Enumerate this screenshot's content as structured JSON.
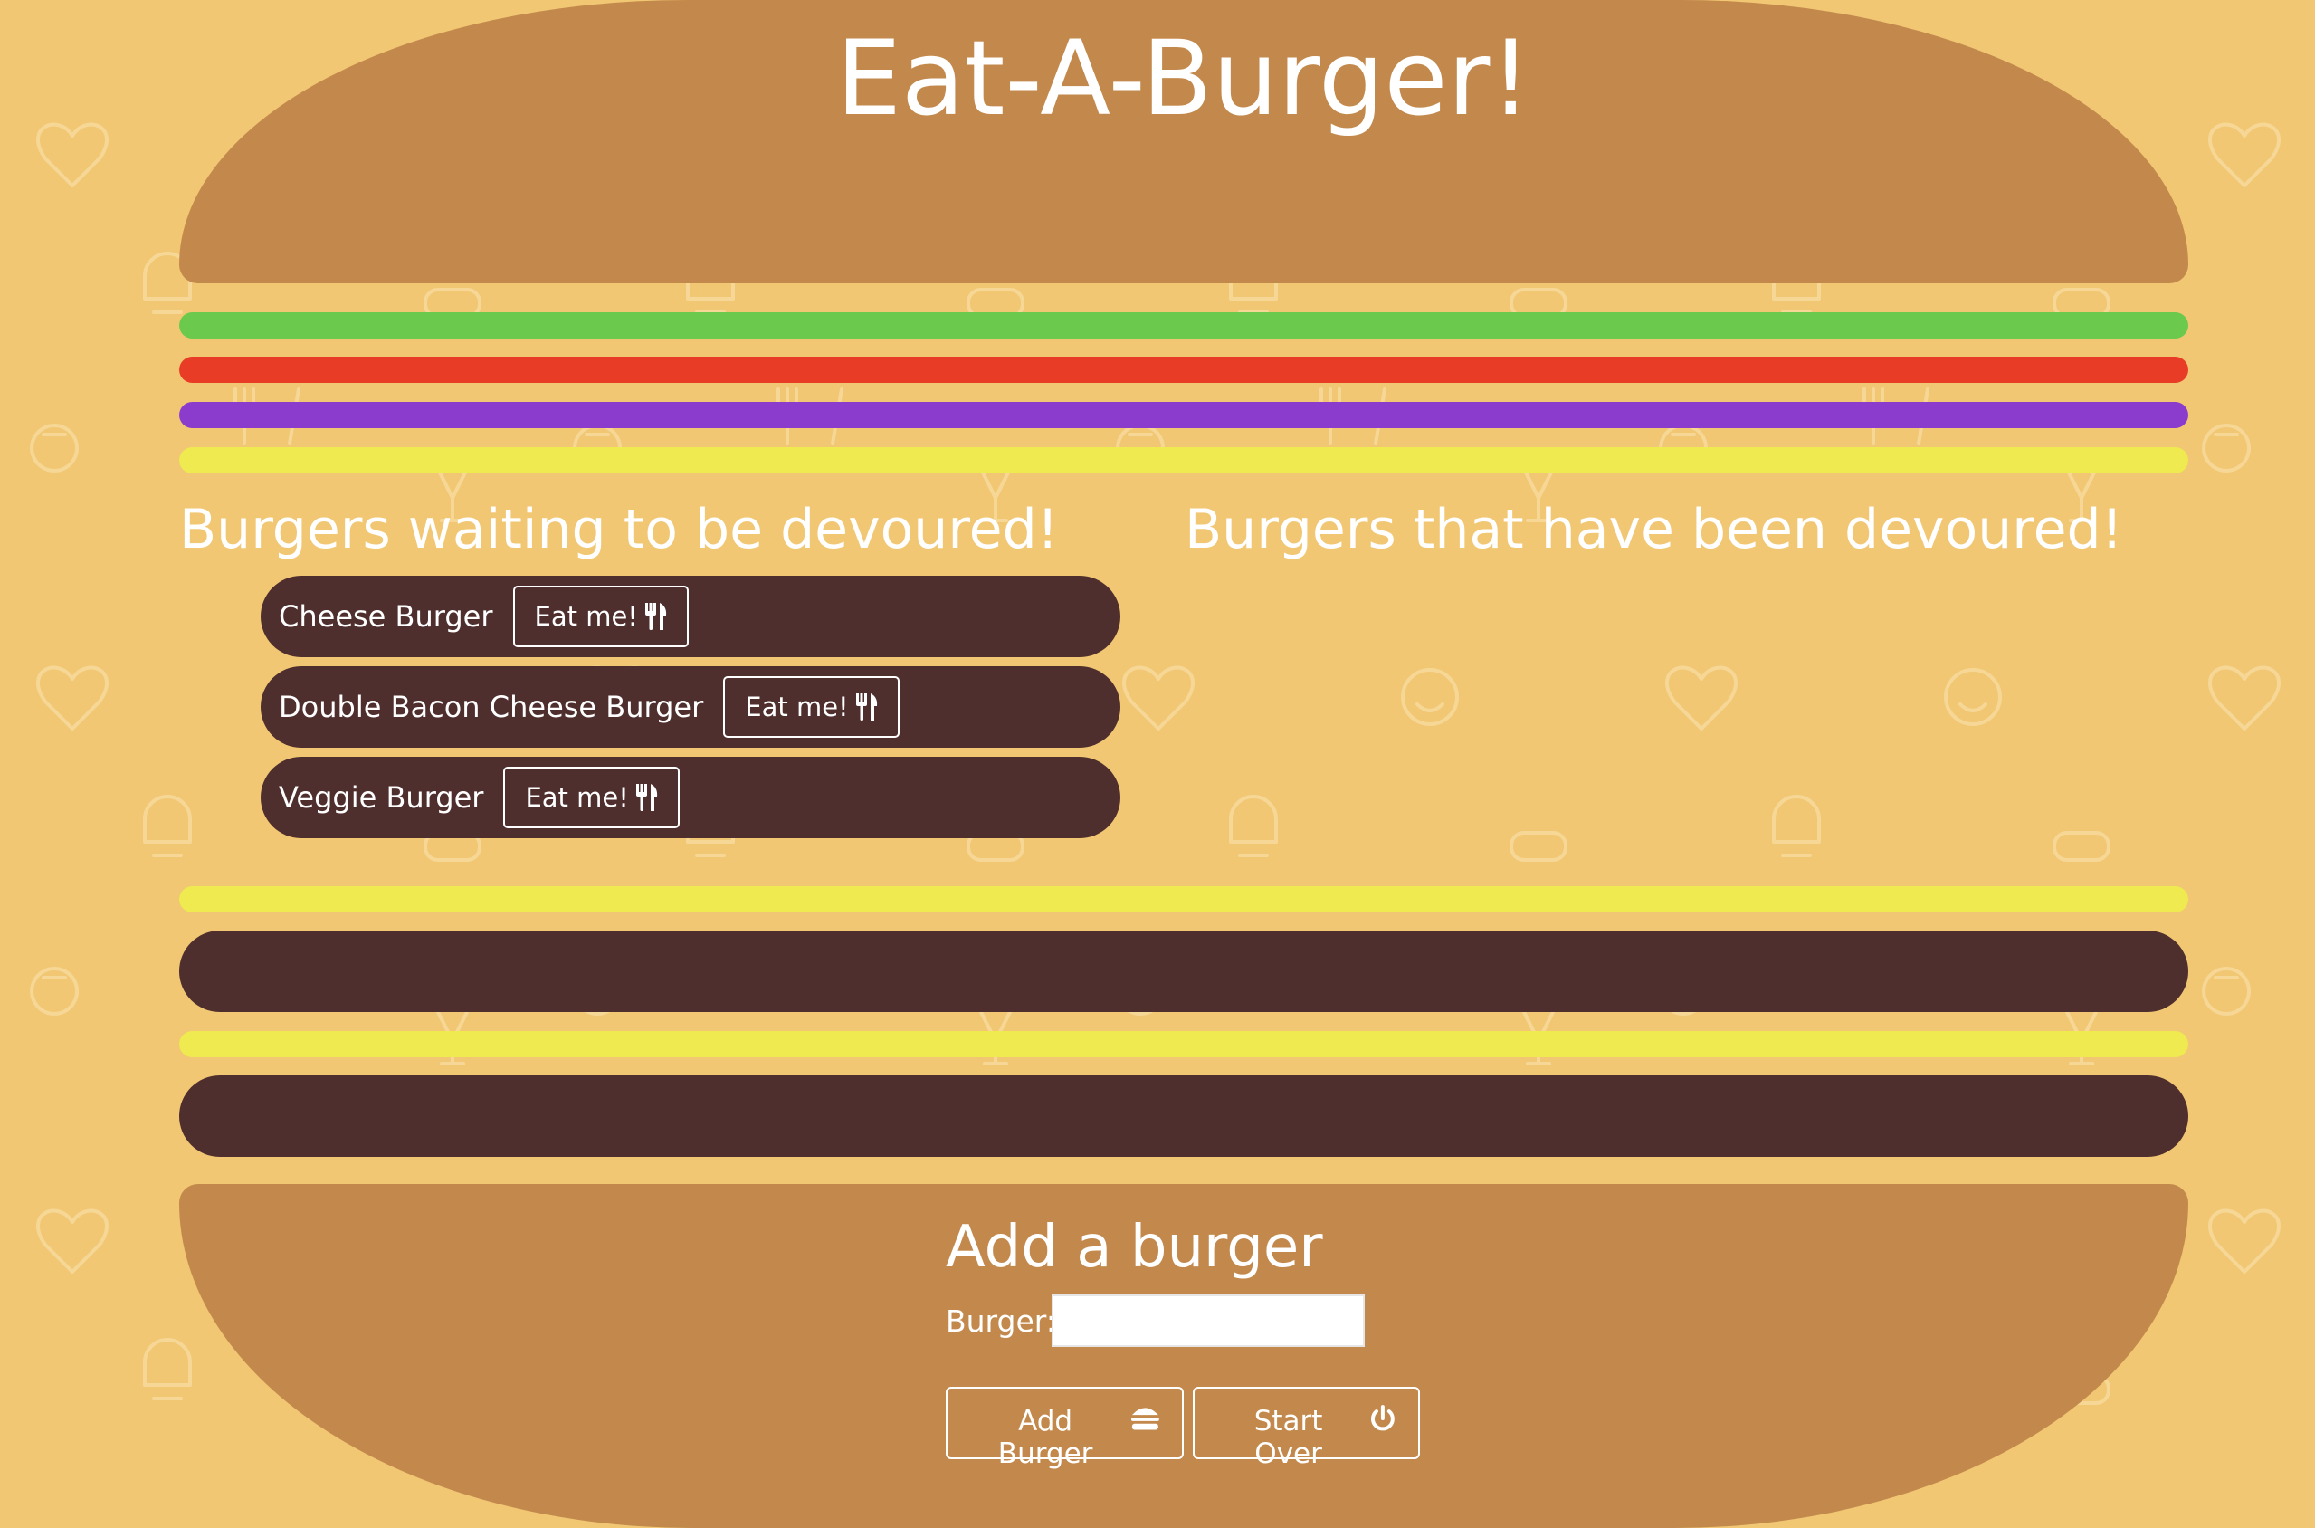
{
  "page": {
    "title": "Eat-A-Burger!"
  },
  "colors": {
    "background": "#f1c773",
    "bun": "#c3894c",
    "lettuce": "#6bc94d",
    "tomato": "#e93c26",
    "onion": "#8c3ccc",
    "cheese": "#eeea4f",
    "patty": "#4f2e2e",
    "text": "#ffffff"
  },
  "waiting": {
    "heading": "Burgers waiting to be devoured!",
    "burgers": [
      {
        "name": "Cheese Burger",
        "button": "Eat me!",
        "icon": "utensils-icon"
      },
      {
        "name": "Double Bacon Cheese Burger",
        "button": "Eat me!",
        "icon": "utensils-icon"
      },
      {
        "name": "Veggie Burger",
        "button": "Eat me!",
        "icon": "utensils-icon"
      }
    ]
  },
  "devoured": {
    "heading": "Burgers that have been devoured!",
    "burgers": []
  },
  "form": {
    "heading": "Add a burger",
    "label": "Burger:",
    "input_value": "",
    "add_button": "Add Burger",
    "add_icon": "hamburger-icon",
    "reset_button": "Start Over",
    "reset_icon": "power-icon"
  }
}
